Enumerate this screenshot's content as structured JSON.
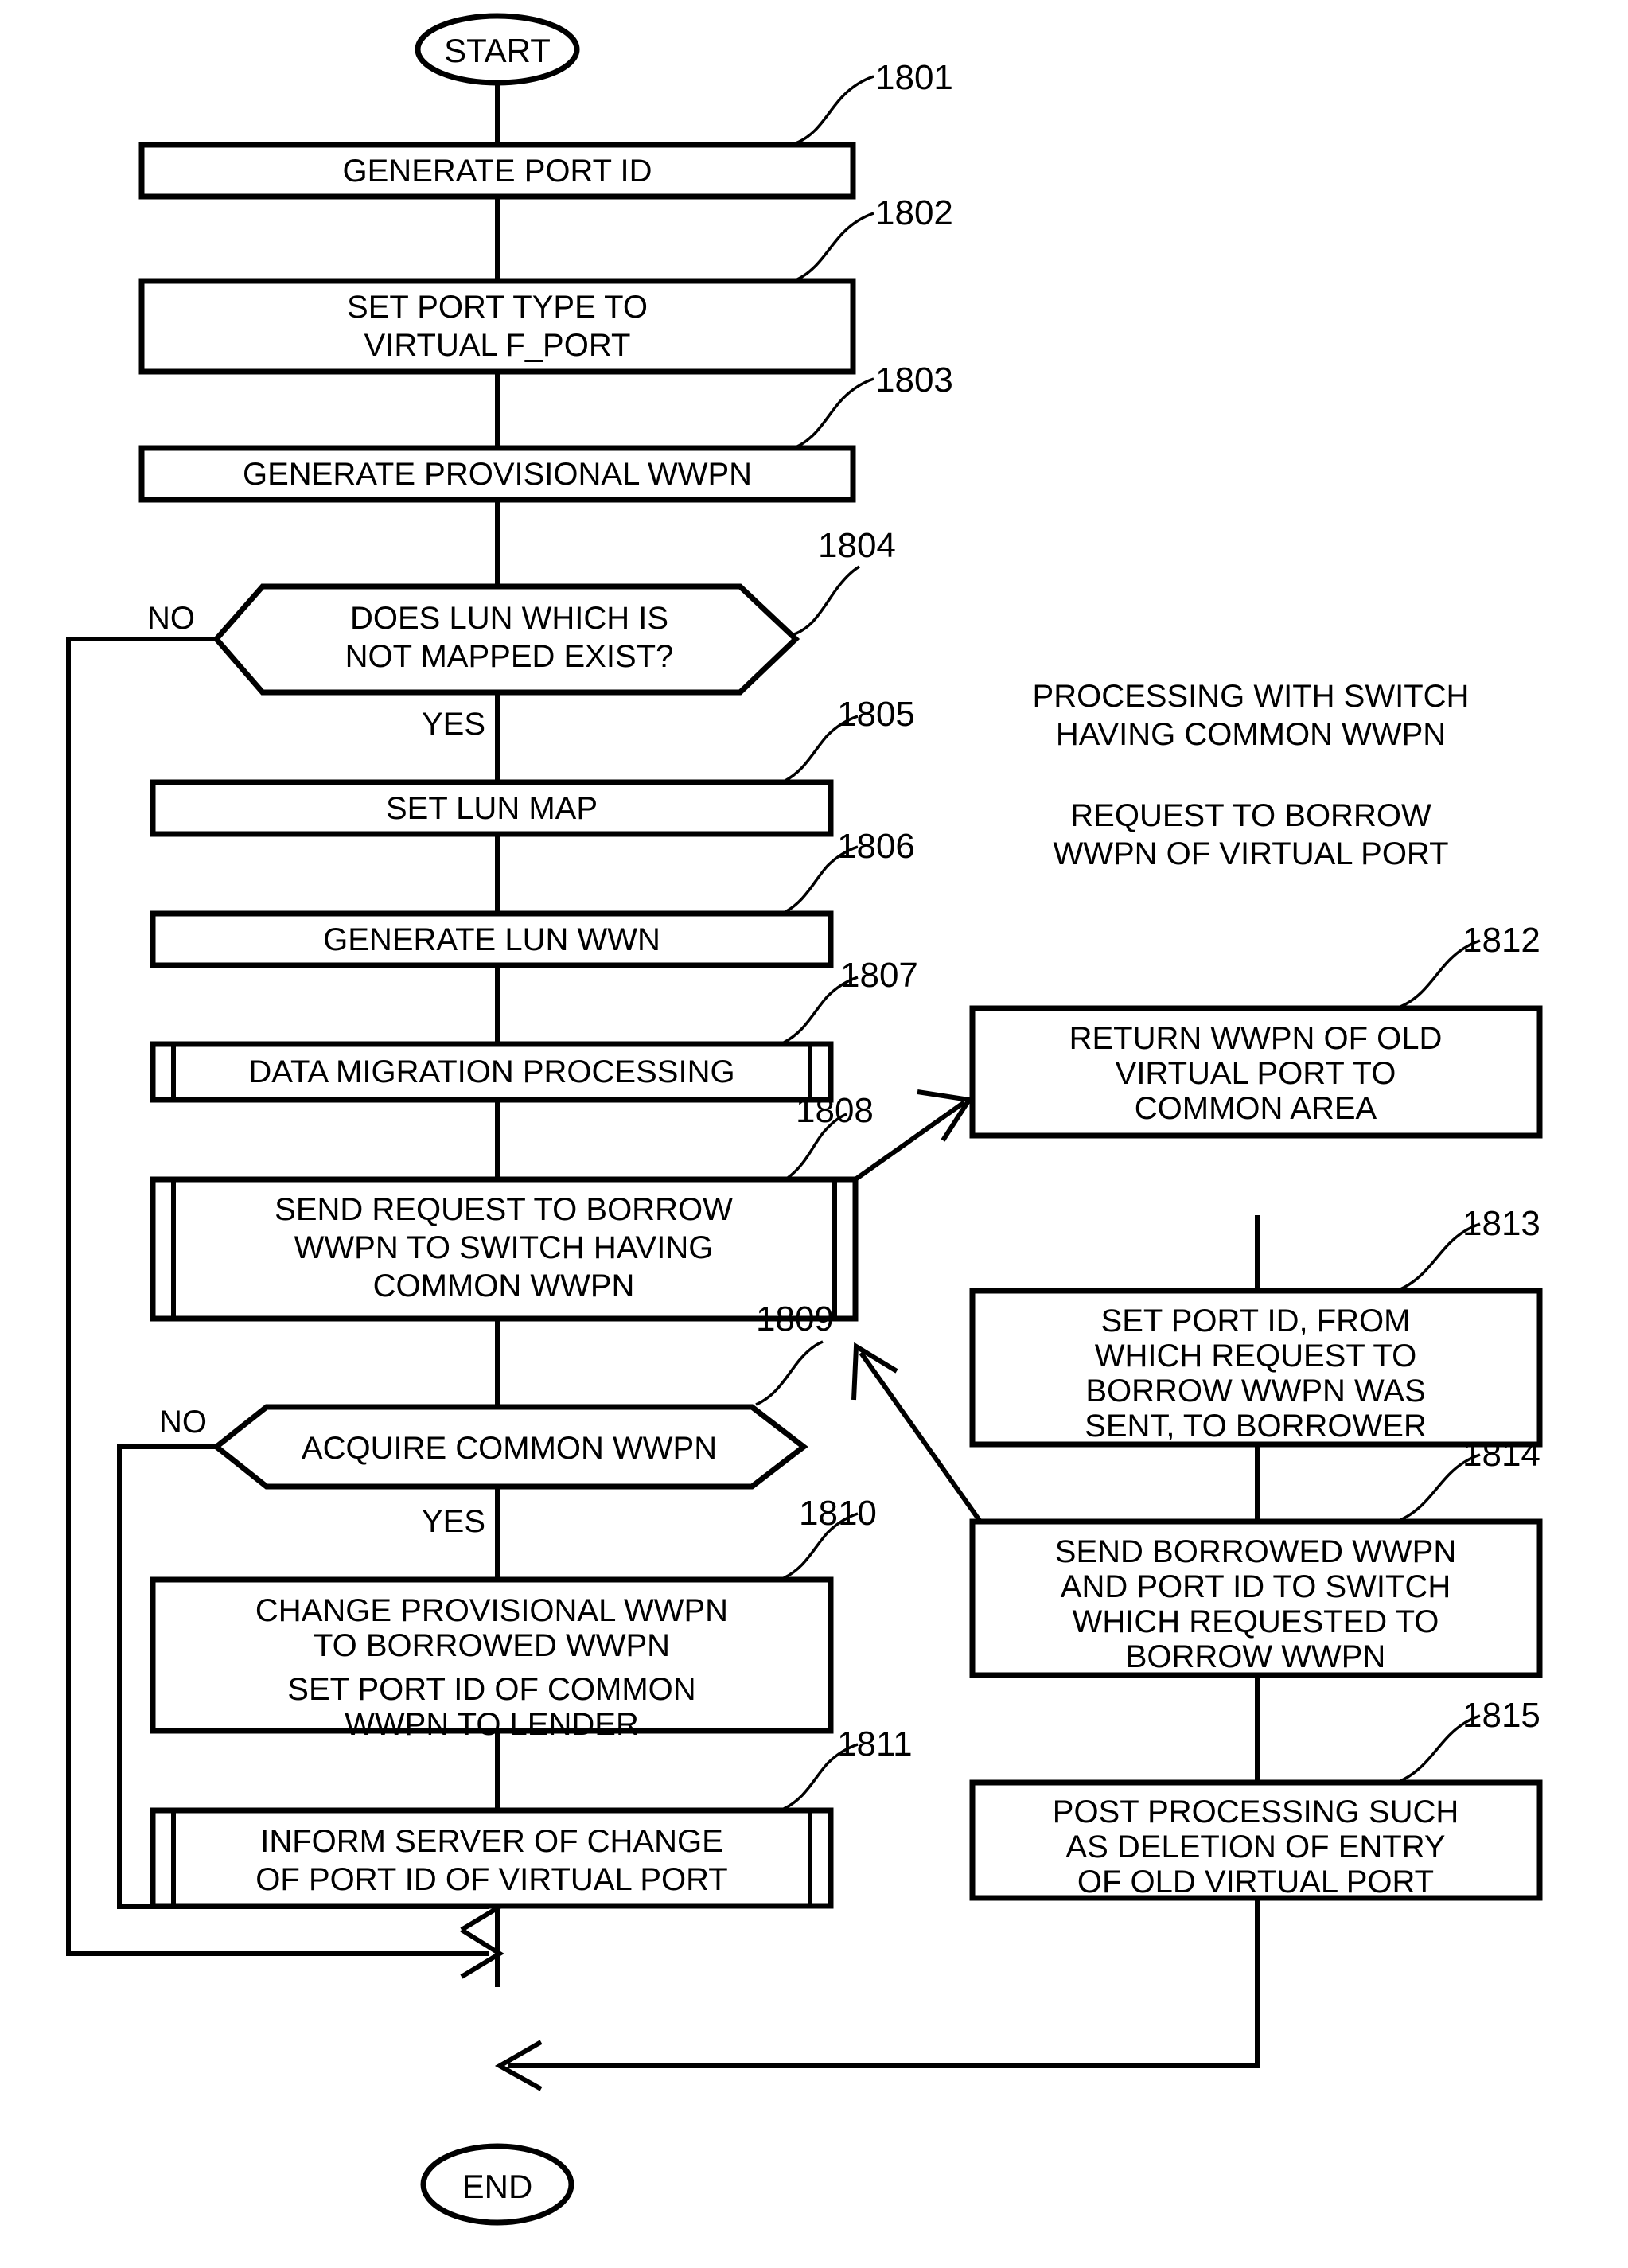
{
  "figure": {
    "terminators": {
      "start": "START",
      "end": "END"
    },
    "branch_labels": {
      "no": "NO",
      "yes": "YES"
    },
    "notes": [
      {
        "id": "note-processing-switch",
        "lines": [
          "PROCESSING WITH SWITCH",
          "HAVING COMMON WWPN"
        ]
      },
      {
        "id": "note-request-borrow",
        "lines": [
          "REQUEST TO BORROW",
          "WWPN OF VIRTUAL PORT"
        ]
      }
    ],
    "left_column": [
      {
        "ref": "1801",
        "type": "process",
        "lines": [
          "GENERATE PORT ID"
        ]
      },
      {
        "ref": "1802",
        "type": "process",
        "lines": [
          "SET PORT TYPE TO",
          "VIRTUAL F_PORT"
        ]
      },
      {
        "ref": "1803",
        "type": "process",
        "lines": [
          "GENERATE PROVISIONAL WWPN"
        ]
      },
      {
        "ref": "1804",
        "type": "decision",
        "lines": [
          "DOES LUN WHICH IS",
          "NOT MAPPED EXIST?"
        ]
      },
      {
        "ref": "1805",
        "type": "process",
        "lines": [
          "SET LUN MAP"
        ]
      },
      {
        "ref": "1806",
        "type": "process",
        "lines": [
          "GENERATE LUN WWN"
        ]
      },
      {
        "ref": "1807",
        "type": "subroutine",
        "lines": [
          "DATA MIGRATION PROCESSING"
        ]
      },
      {
        "ref": "1808",
        "type": "subroutine",
        "lines": [
          "SEND REQUEST TO BORROW",
          "WWPN TO SWITCH HAVING",
          "COMMON WWPN"
        ]
      },
      {
        "ref": "1809",
        "type": "decision",
        "lines": [
          "ACQUIRE COMMON WWPN"
        ]
      },
      {
        "ref": "1810",
        "type": "process",
        "lines": [
          "CHANGE PROVISIONAL WWPN",
          "TO BORROWED WWPN",
          "",
          "SET PORT ID OF COMMON",
          "WWPN TO LENDER"
        ]
      },
      {
        "ref": "1811",
        "type": "subroutine",
        "lines": [
          "INFORM SERVER OF CHANGE",
          "OF PORT ID OF VIRTUAL PORT"
        ]
      }
    ],
    "right_column": [
      {
        "ref": "1812",
        "type": "process",
        "lines": [
          "RETURN WWPN OF OLD",
          "VIRTUAL PORT TO",
          "COMMON AREA"
        ]
      },
      {
        "ref": "1813",
        "type": "process",
        "lines": [
          "SET PORT ID, FROM",
          "WHICH REQUEST TO",
          "BORROW WWPN WAS",
          "SENT, TO BORROWER"
        ]
      },
      {
        "ref": "1814",
        "type": "process",
        "lines": [
          "SEND BORROWED WWPN",
          "AND PORT ID TO SWITCH",
          "WHICH REQUESTED TO",
          "BORROW WWPN"
        ]
      },
      {
        "ref": "1815",
        "type": "process",
        "lines": [
          "POST PROCESSING SUCH",
          "AS DELETION OF ENTRY",
          "OF OLD VIRTUAL PORT"
        ]
      }
    ],
    "colors": {
      "ink": "#000000",
      "paper": "#ffffff"
    }
  }
}
